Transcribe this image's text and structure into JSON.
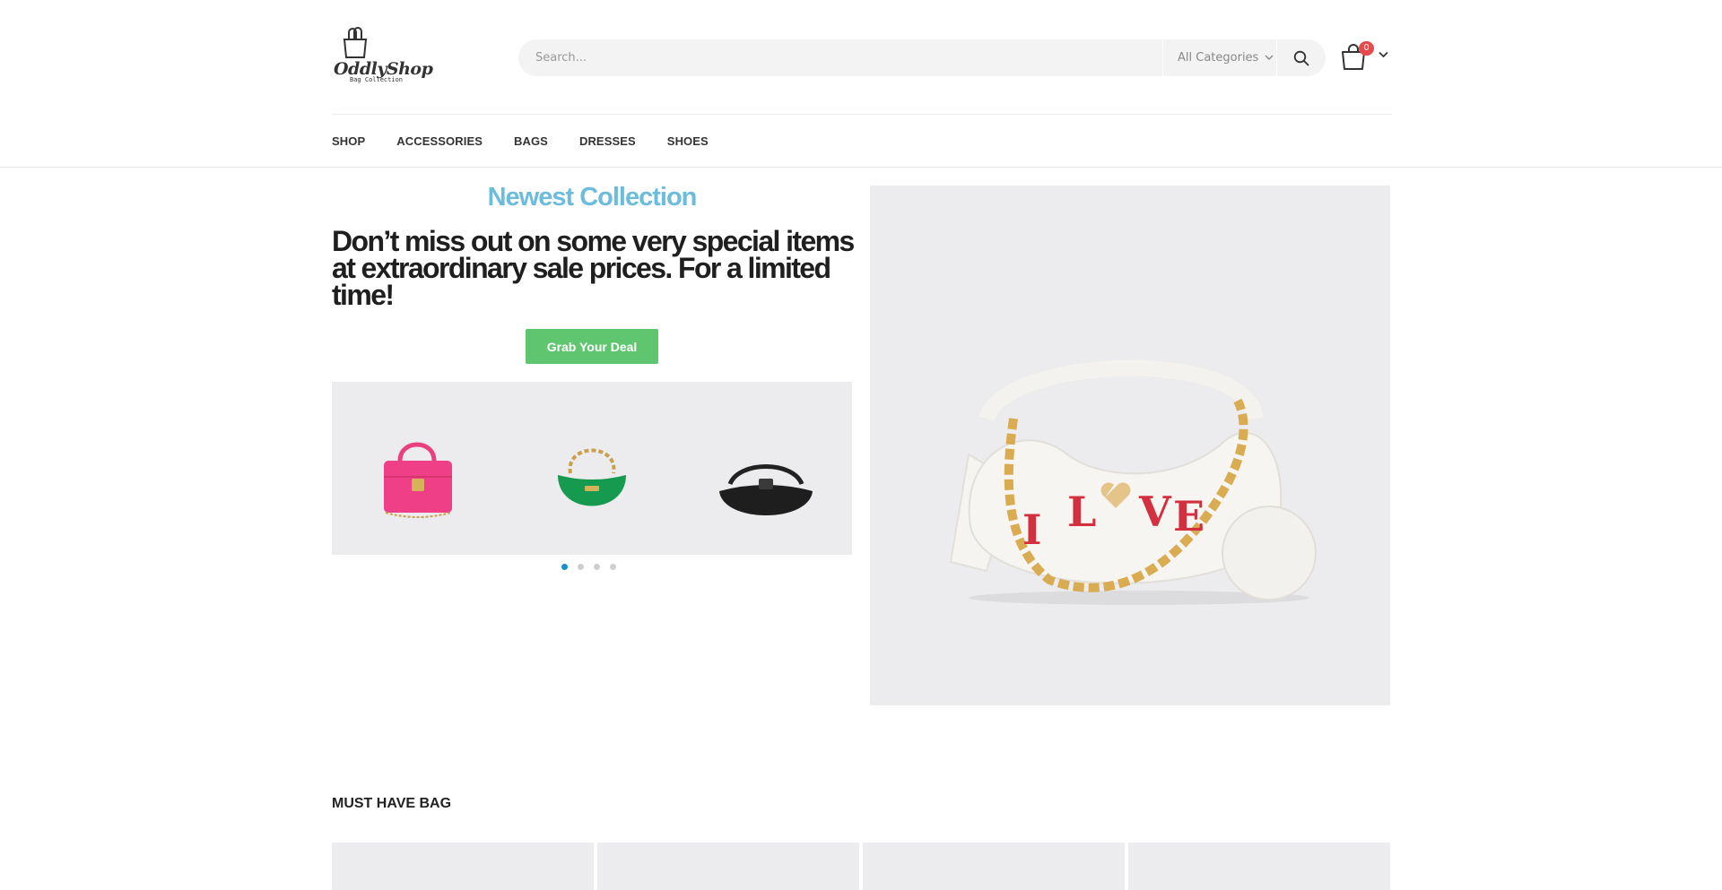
{
  "brand": {
    "logo_text": "OddlyShop",
    "logo_subtext": "Bag Collection"
  },
  "search": {
    "placeholder": "Search...",
    "category": "All Categories"
  },
  "cart": {
    "count": "0"
  },
  "nav": {
    "items": [
      "SHOP",
      "ACCESSORIES",
      "BAGS",
      "DRESSES",
      "SHOES"
    ]
  },
  "hero": {
    "eyebrow": "Newest Collection",
    "title": "Don’t miss out on some very special items at extraordinary sale prices. For a limited time!",
    "cta_label": "Grab Your Deal",
    "carousel_products": [
      "pink handbag",
      "green handbag",
      "black handbag"
    ],
    "carousel_pages": 4,
    "carousel_active_page": 1,
    "featured_product_letters": [
      "I",
      "L",
      "V",
      "E"
    ]
  },
  "section": {
    "title": "MUST HAVE BAG",
    "tiles": 4
  },
  "colors": {
    "accent_blue": "#6cbcdb",
    "cta_green": "#5fc56f",
    "badge_red": "#e74a4a",
    "dot_active": "#1b8fcc"
  }
}
